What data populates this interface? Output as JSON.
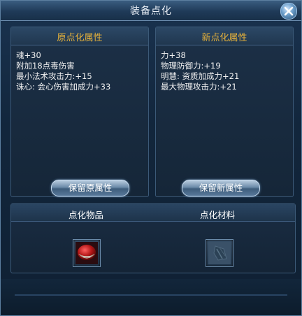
{
  "window": {
    "title": "装备点化"
  },
  "close_button": {
    "icon": "close-x-icon"
  },
  "left_panel": {
    "header": "原点化属性",
    "attributes": [
      "魂+30",
      "附加18点毒伤害",
      "最小法术攻击力:+15",
      "诛心: 会心伤害加成力+33"
    ],
    "keep_label": "保留原属性"
  },
  "right_panel": {
    "header": "新点化属性",
    "attributes": [
      "力+38",
      "物理防御力:+19",
      "明慧: 资质加成力+21",
      "最大物理攻击力:+21"
    ],
    "keep_label": "保留新属性"
  },
  "bottom": {
    "item_label": "点化物品",
    "material_label": "点化材料",
    "item_icon": "red-equipment-icon",
    "material_icon": "empty-material-icon"
  },
  "colors": {
    "header_gold": "#e7b23a",
    "text": "#f0f0f0",
    "window_bg": "#12263c"
  }
}
